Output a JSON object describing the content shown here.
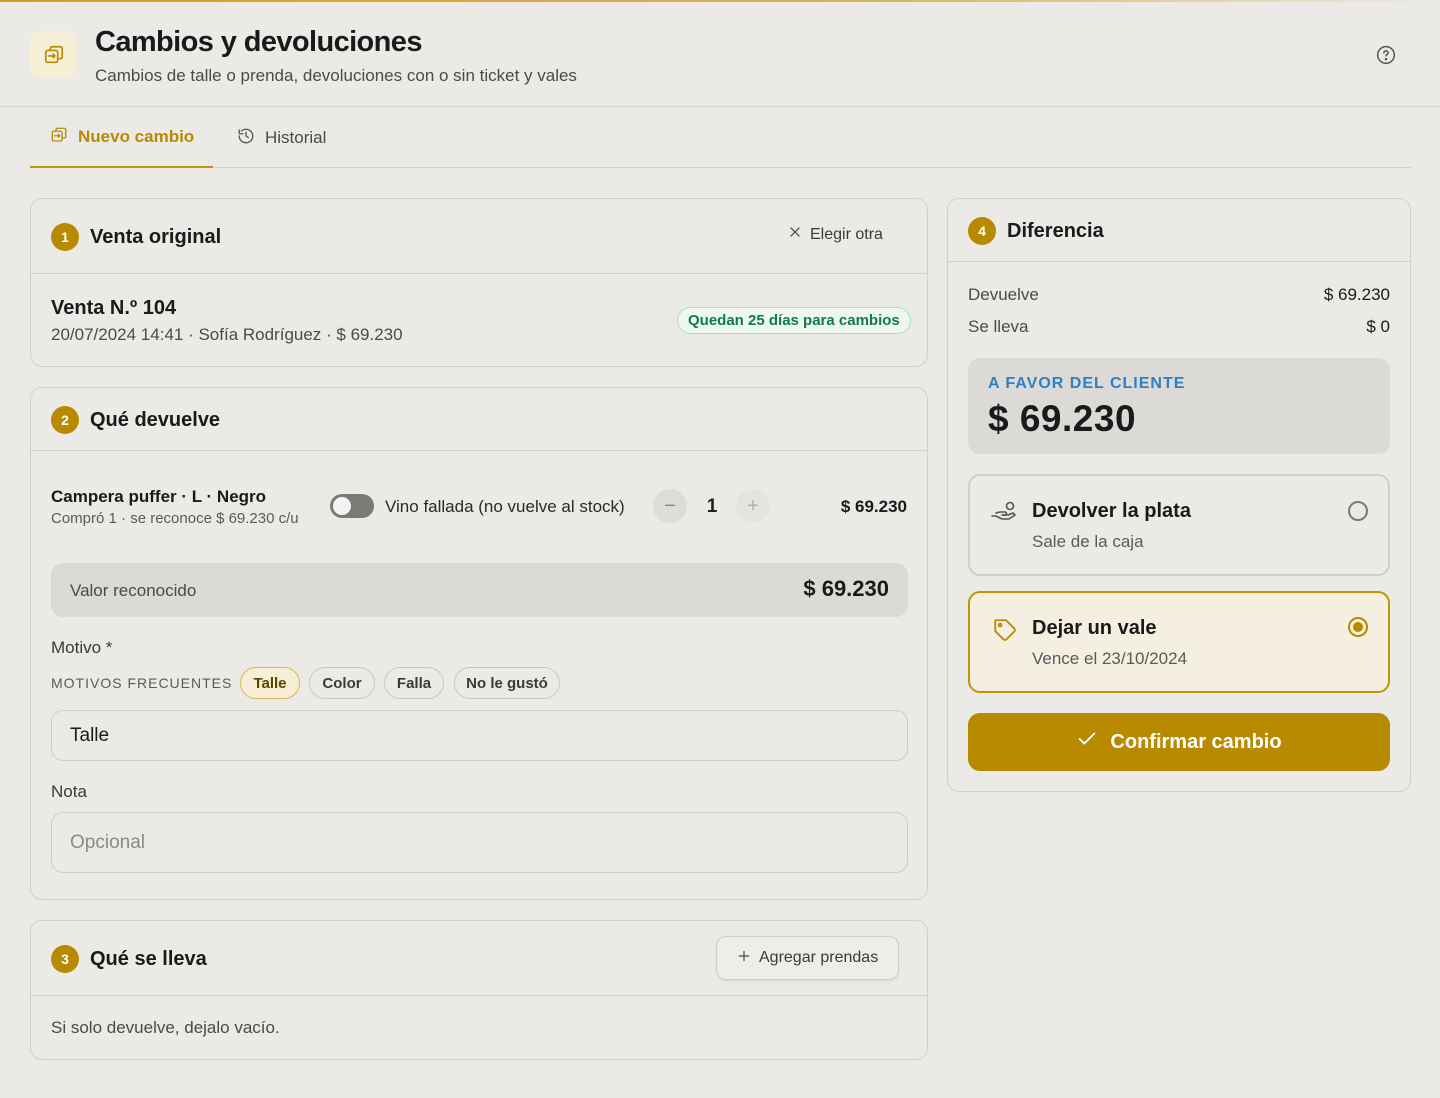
{
  "header": {
    "title": "Cambios y devoluciones",
    "subtitle": "Cambios de talle o prenda, devoluciones con o sin ticket y vales"
  },
  "tabs": [
    {
      "label": "Nuevo cambio",
      "icon": "swap-icon",
      "active": true
    },
    {
      "label": "Historial",
      "icon": "history-icon",
      "active": false
    }
  ],
  "original_sale": {
    "step": "1",
    "title": "Venta original",
    "choose_other_label": "Elegir otra",
    "sale_title": "Venta N.º 104",
    "sale_meta": "20/07/2024 14:41 · Sofía Rodríguez · $ 69.230",
    "days_badge": "Quedan 25 días para cambios"
  },
  "returns": {
    "step": "2",
    "title": "Qué devuelve",
    "item_name": "Campera puffer · L · Negro",
    "item_meta": "Compró 1 · se reconoce $ 69.230 c/u",
    "defective_label": "Vino fallada (no vuelve al stock)",
    "defective_on": false,
    "qty_minus": "−",
    "quantity": "1",
    "qty_plus": "+",
    "item_total": "$ 69.230",
    "recognized_label": "Valor reconocido",
    "recognized_value": "$ 69.230",
    "reason_label": "Motivo *",
    "frequent_label": "MOTIVOS FRECUENTES",
    "chips": [
      {
        "label": "Talle",
        "selected": true
      },
      {
        "label": "Color",
        "selected": false
      },
      {
        "label": "Falla",
        "selected": false
      },
      {
        "label": "No le gustó",
        "selected": false
      }
    ],
    "reason_value": "Talle",
    "note_label": "Nota",
    "note_placeholder": "Opcional"
  },
  "takes": {
    "step": "3",
    "title": "Qué se lleva",
    "add_label": "Agregar prendas",
    "hint": "Si solo devuelve, dejalo vacío."
  },
  "difference": {
    "step": "4",
    "title": "Diferencia",
    "returns_label": "Devuelve",
    "returns_value": "$ 69.230",
    "takes_label": "Se lleva",
    "takes_value": "$ 0",
    "favor_label": "A FAVOR DEL CLIENTE",
    "favor_value": "$ 69.230",
    "options": [
      {
        "title": "Devolver la plata",
        "subtitle": "Sale de la caja",
        "icon": "hand-money-icon",
        "selected": false
      },
      {
        "title": "Dejar un vale",
        "subtitle": "Vence el 23/10/2024",
        "icon": "tag-icon",
        "selected": true
      }
    ],
    "confirm_label": "Confirmar cambio"
  },
  "colors": {
    "accent": "#b88a00",
    "background": "#eceae7",
    "success": "#127a4a",
    "info": "#2f7fc4"
  }
}
